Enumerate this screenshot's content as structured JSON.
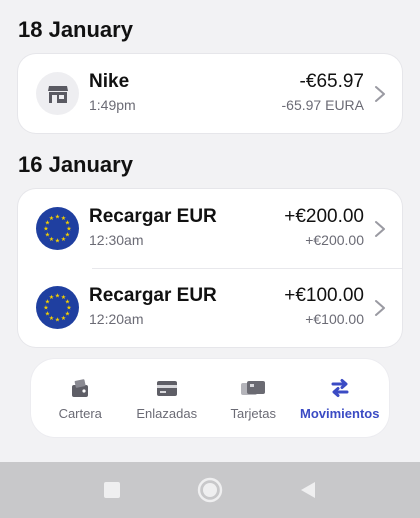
{
  "groups": [
    {
      "date": "18 January",
      "transactions": [
        {
          "title": "Nike",
          "time": "1:49pm",
          "amount": "-€65.97",
          "sub_amount": "-65.97 EURA",
          "icon": "store-icon"
        }
      ]
    },
    {
      "date": "16 January",
      "transactions": [
        {
          "title": "Recargar EUR",
          "time": "12:30am",
          "amount": "+€200.00",
          "sub_amount": "+€200.00",
          "icon": "eu-flag-icon"
        },
        {
          "title": "Recargar EUR",
          "time": "12:20am",
          "amount": "+€100.00",
          "sub_amount": "+€100.00",
          "icon": "eu-flag-icon"
        }
      ]
    }
  ],
  "nav": {
    "items": [
      {
        "label": "Cartera",
        "icon": "wallet-icon",
        "active": false
      },
      {
        "label": "Enlazadas",
        "icon": "linked-card-icon",
        "active": false
      },
      {
        "label": "Tarjetas",
        "icon": "cards-icon",
        "active": false
      },
      {
        "label": "Movimientos",
        "icon": "transfer-arrows-icon",
        "active": true
      }
    ]
  },
  "colors": {
    "accent": "#3b4bc4",
    "eu_blue": "#1f3fa0",
    "eu_star": "#f5d000",
    "muted_text": "#6b6b75",
    "background": "#f2f2f4",
    "system_bar": "#c8c8ca"
  },
  "system_nav": [
    "recents-square-icon",
    "home-circle-icon",
    "back-triangle-icon"
  ]
}
